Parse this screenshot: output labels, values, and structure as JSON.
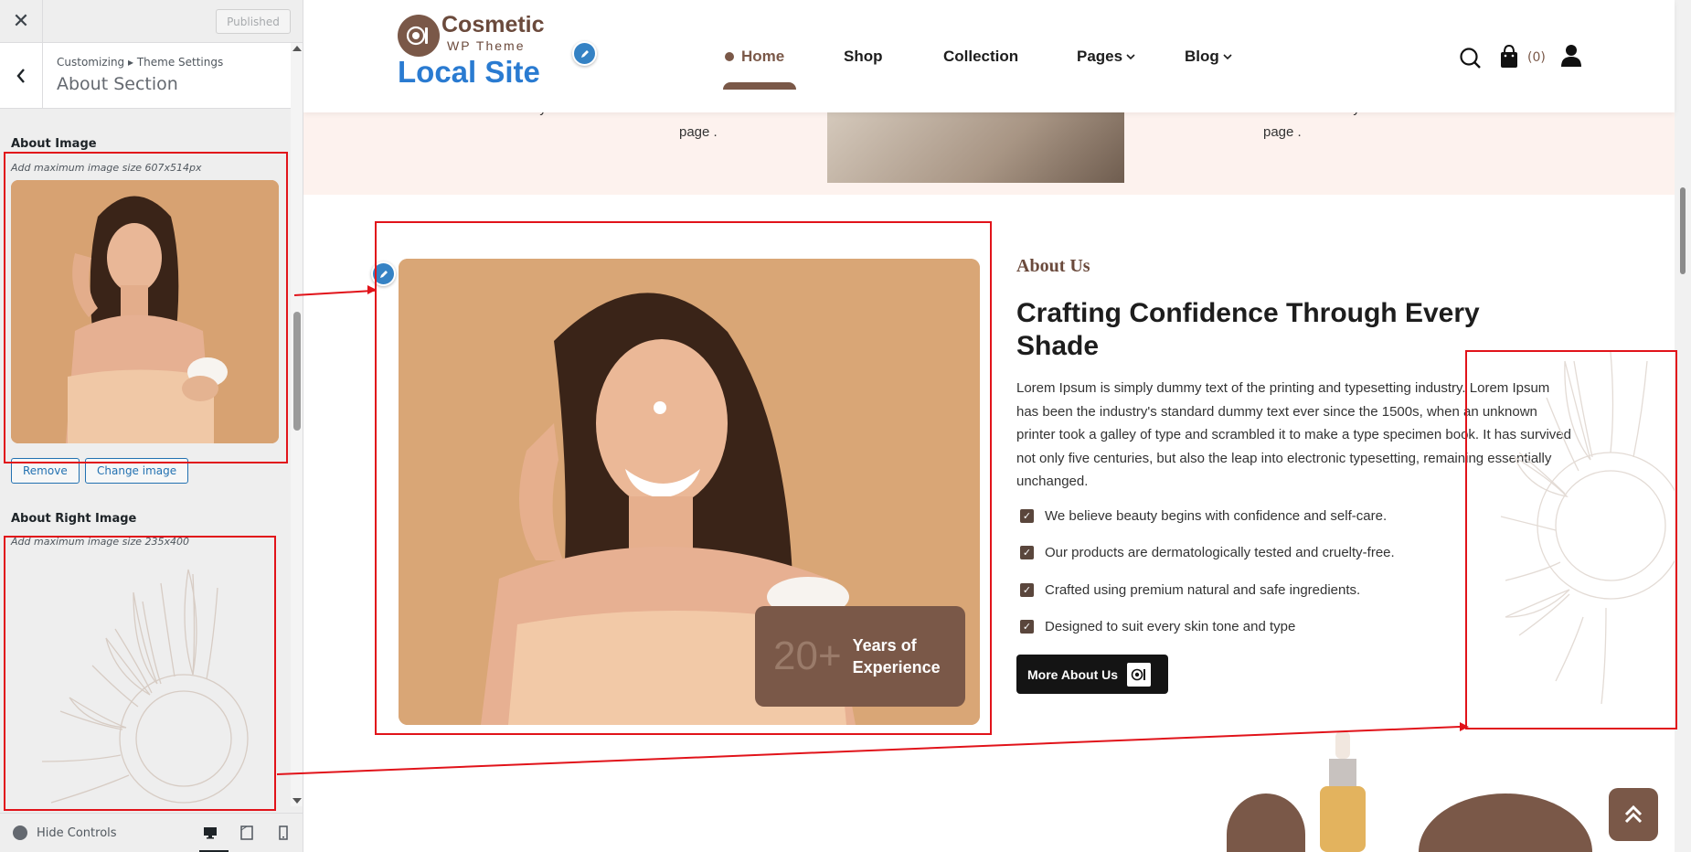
{
  "customizer": {
    "published_label": "Published",
    "breadcrumb": "Customizing ▸ Theme Settings",
    "section_title": "About Section",
    "about_image": {
      "label": "About Image",
      "description": "Add maximum image size 607x514px",
      "remove_label": "Remove",
      "change_label": "Change image"
    },
    "about_right_image": {
      "label": "About Right Image",
      "description": "Add maximum image size 235x400"
    },
    "hide_controls_label": "Hide Controls",
    "devices": [
      "desktop-icon",
      "tablet-icon",
      "mobile-icon"
    ]
  },
  "site": {
    "logo_name": "Cosmetic",
    "logo_sub": "WP Theme",
    "site_title": "Local Site",
    "nav": [
      {
        "label": "Home"
      },
      {
        "label": "Shop"
      },
      {
        "label": "Collection"
      },
      {
        "label": "Pages"
      },
      {
        "label": "Blog"
      }
    ],
    "cart_count": "(0)"
  },
  "band": {
    "left_text_line1": "be distracted by the readable content of a",
    "left_text_line2": "page .",
    "right_text_line1": "be distracted by the readable content of a",
    "right_text_line2": "page ."
  },
  "about": {
    "kicker": "About Us",
    "heading": "Crafting Confidence Through Every Shade",
    "paragraph": "Lorem Ipsum is simply dummy text of the printing and typesetting industry. Lorem Ipsum has been the industry's standard dummy text ever since the 1500s, when an unknown printer took a galley of type and scrambled it to make a type specimen book. It has survived not only five centuries, but also the leap into electronic typesetting, remaining essentially unchanged.",
    "checklist": [
      "We believe beauty begins with confidence and self-care.",
      "Our products are dermatologically tested and cruelty-free.",
      "Crafted using premium natural and safe ingredients.",
      "Designed to suit every skin tone and type"
    ],
    "experience_number": "20+",
    "experience_text_1": "Years of",
    "experience_text_2": "Experience",
    "button_label": "More About Us"
  },
  "colors": {
    "brand_brown": "#7a5848",
    "site_title_blue": "#2a7bd1",
    "annotation_red": "#e1131a",
    "wp_blue": "#2271b1"
  }
}
